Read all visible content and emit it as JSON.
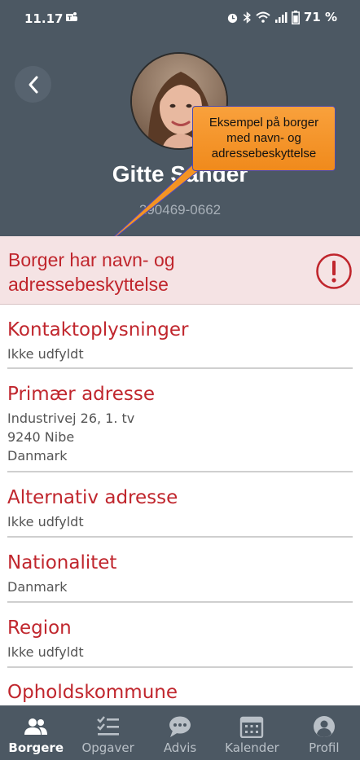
{
  "status_bar": {
    "time": "11.17",
    "battery": "71 %"
  },
  "patient": {
    "name": "Gitte Sander",
    "cpr": "290469-0662"
  },
  "callout": {
    "text": "Eksempel på borger med navn- og adressebeskyttelse"
  },
  "alert": {
    "text": "Borger har navn- og adressebeskyttelse"
  },
  "sections": [
    {
      "title": "Kontaktoplysninger",
      "lines": [
        "Ikke udfyldt"
      ]
    },
    {
      "title": "Primær adresse",
      "lines": [
        "Industrivej 26, 1. tv",
        "9240 Nibe",
        "Danmark"
      ]
    },
    {
      "title": "Alternativ adresse",
      "lines": [
        "Ikke udfyldt"
      ]
    },
    {
      "title": "Nationalitet",
      "lines": [
        "Danmark"
      ]
    },
    {
      "title": "Region",
      "lines": [
        "Ikke udfyldt"
      ]
    },
    {
      "title": "Opholdskommune",
      "lines": []
    }
  ],
  "nav": {
    "items": [
      {
        "label": "Borgere",
        "icon": "people-icon",
        "active": true
      },
      {
        "label": "Opgaver",
        "icon": "checklist-icon",
        "active": false
      },
      {
        "label": "Advis",
        "icon": "chat-bubble-icon",
        "active": false
      },
      {
        "label": "Kalender",
        "icon": "calendar-icon",
        "active": false
      },
      {
        "label": "Profil",
        "icon": "person-icon",
        "active": false
      }
    ]
  },
  "colors": {
    "header": "#4c5863",
    "accent": "#c0262d",
    "alert_bg": "#f5e3e4",
    "callout": "#f39324"
  }
}
